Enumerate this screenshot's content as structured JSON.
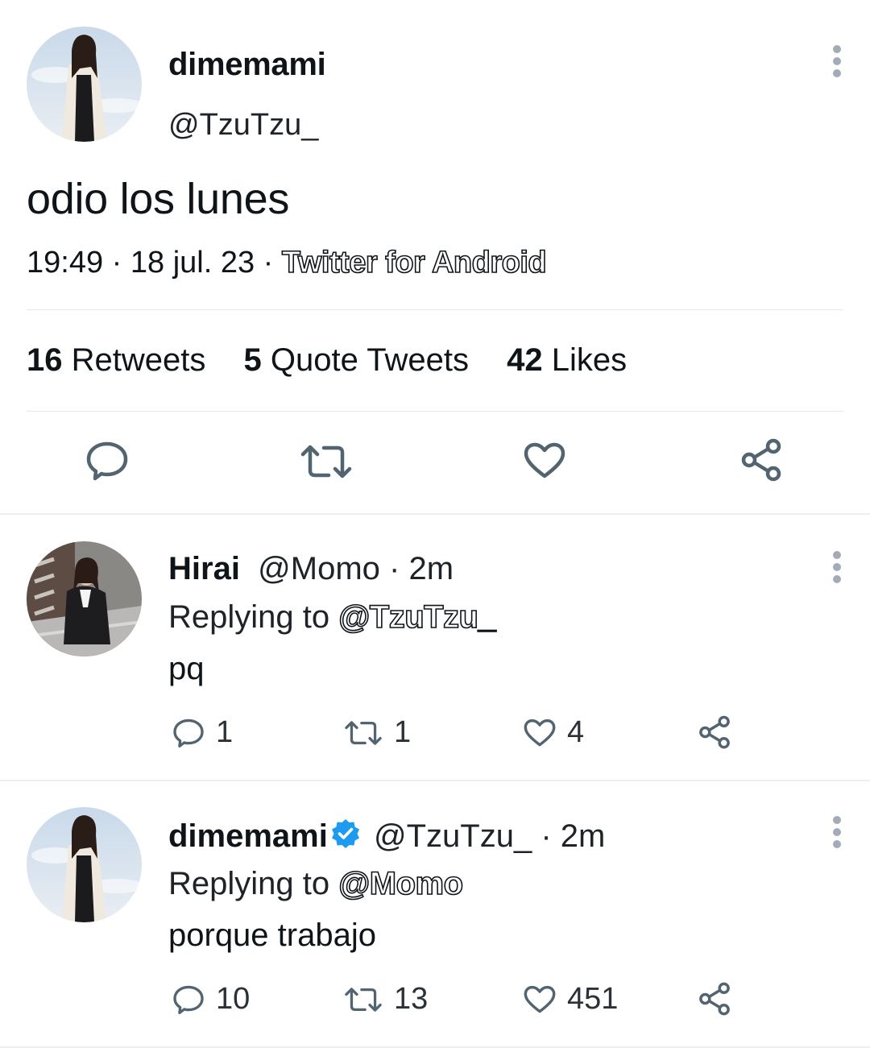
{
  "main_tweet": {
    "author_name": "dimemami",
    "author_handle": "@TzuTzu_",
    "text": "odio los lunes",
    "time": "19:49",
    "date": "18 jul. 23",
    "separator": " · ",
    "source": "Twitter for Android",
    "stats": {
      "retweets_count": "16",
      "retweets_label": "Retweets",
      "quotes_count": "5",
      "quotes_label": "Quote Tweets",
      "likes_count": "42",
      "likes_label": "Likes"
    },
    "icons": [
      "reply-icon",
      "retweet-icon",
      "like-icon",
      "share-icon",
      "more-options-icon"
    ]
  },
  "replies": [
    {
      "author_name": "Hirai",
      "author_handle": "@Momo",
      "time": "· 2m",
      "replying_label": "Replying to",
      "replying_to": "@TzuTzu_",
      "text": "pq",
      "reply_count": "1",
      "retweet_count": "1",
      "like_count": "4",
      "verified": false
    },
    {
      "author_name": "dimemami",
      "author_handle": "@TzuTzu_",
      "time": "· 2m",
      "replying_label": "Replying to",
      "replying_to": "@Momo",
      "text": "porque trabajo",
      "reply_count": "10",
      "retweet_count": "13",
      "like_count": "451",
      "verified": true
    }
  ],
  "colors": {
    "text": "#0f1419",
    "icon": "#536471",
    "divider": "#e6e9ec",
    "verified": "#1d9bf0"
  }
}
